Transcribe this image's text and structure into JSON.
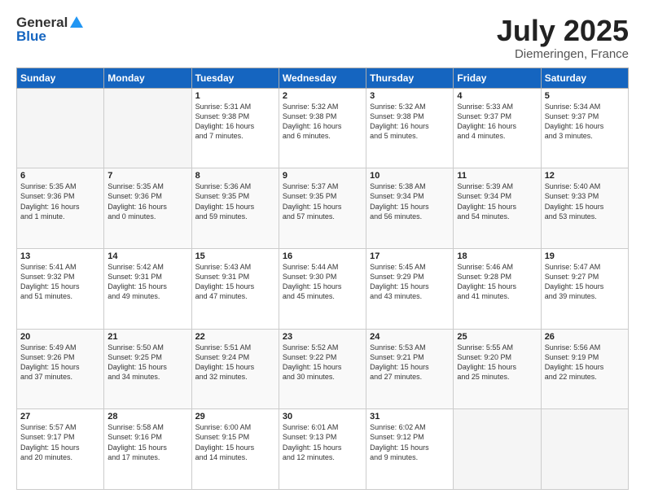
{
  "header": {
    "logo_general": "General",
    "logo_blue": "Blue",
    "title": "July 2025",
    "location": "Diemeringen, France"
  },
  "weekdays": [
    "Sunday",
    "Monday",
    "Tuesday",
    "Wednesday",
    "Thursday",
    "Friday",
    "Saturday"
  ],
  "weeks": [
    [
      {
        "day": "",
        "info": ""
      },
      {
        "day": "",
        "info": ""
      },
      {
        "day": "1",
        "info": "Sunrise: 5:31 AM\nSunset: 9:38 PM\nDaylight: 16 hours\nand 7 minutes."
      },
      {
        "day": "2",
        "info": "Sunrise: 5:32 AM\nSunset: 9:38 PM\nDaylight: 16 hours\nand 6 minutes."
      },
      {
        "day": "3",
        "info": "Sunrise: 5:32 AM\nSunset: 9:38 PM\nDaylight: 16 hours\nand 5 minutes."
      },
      {
        "day": "4",
        "info": "Sunrise: 5:33 AM\nSunset: 9:37 PM\nDaylight: 16 hours\nand 4 minutes."
      },
      {
        "day": "5",
        "info": "Sunrise: 5:34 AM\nSunset: 9:37 PM\nDaylight: 16 hours\nand 3 minutes."
      }
    ],
    [
      {
        "day": "6",
        "info": "Sunrise: 5:35 AM\nSunset: 9:36 PM\nDaylight: 16 hours\nand 1 minute."
      },
      {
        "day": "7",
        "info": "Sunrise: 5:35 AM\nSunset: 9:36 PM\nDaylight: 16 hours\nand 0 minutes."
      },
      {
        "day": "8",
        "info": "Sunrise: 5:36 AM\nSunset: 9:35 PM\nDaylight: 15 hours\nand 59 minutes."
      },
      {
        "day": "9",
        "info": "Sunrise: 5:37 AM\nSunset: 9:35 PM\nDaylight: 15 hours\nand 57 minutes."
      },
      {
        "day": "10",
        "info": "Sunrise: 5:38 AM\nSunset: 9:34 PM\nDaylight: 15 hours\nand 56 minutes."
      },
      {
        "day": "11",
        "info": "Sunrise: 5:39 AM\nSunset: 9:34 PM\nDaylight: 15 hours\nand 54 minutes."
      },
      {
        "day": "12",
        "info": "Sunrise: 5:40 AM\nSunset: 9:33 PM\nDaylight: 15 hours\nand 53 minutes."
      }
    ],
    [
      {
        "day": "13",
        "info": "Sunrise: 5:41 AM\nSunset: 9:32 PM\nDaylight: 15 hours\nand 51 minutes."
      },
      {
        "day": "14",
        "info": "Sunrise: 5:42 AM\nSunset: 9:31 PM\nDaylight: 15 hours\nand 49 minutes."
      },
      {
        "day": "15",
        "info": "Sunrise: 5:43 AM\nSunset: 9:31 PM\nDaylight: 15 hours\nand 47 minutes."
      },
      {
        "day": "16",
        "info": "Sunrise: 5:44 AM\nSunset: 9:30 PM\nDaylight: 15 hours\nand 45 minutes."
      },
      {
        "day": "17",
        "info": "Sunrise: 5:45 AM\nSunset: 9:29 PM\nDaylight: 15 hours\nand 43 minutes."
      },
      {
        "day": "18",
        "info": "Sunrise: 5:46 AM\nSunset: 9:28 PM\nDaylight: 15 hours\nand 41 minutes."
      },
      {
        "day": "19",
        "info": "Sunrise: 5:47 AM\nSunset: 9:27 PM\nDaylight: 15 hours\nand 39 minutes."
      }
    ],
    [
      {
        "day": "20",
        "info": "Sunrise: 5:49 AM\nSunset: 9:26 PM\nDaylight: 15 hours\nand 37 minutes."
      },
      {
        "day": "21",
        "info": "Sunrise: 5:50 AM\nSunset: 9:25 PM\nDaylight: 15 hours\nand 34 minutes."
      },
      {
        "day": "22",
        "info": "Sunrise: 5:51 AM\nSunset: 9:24 PM\nDaylight: 15 hours\nand 32 minutes."
      },
      {
        "day": "23",
        "info": "Sunrise: 5:52 AM\nSunset: 9:22 PM\nDaylight: 15 hours\nand 30 minutes."
      },
      {
        "day": "24",
        "info": "Sunrise: 5:53 AM\nSunset: 9:21 PM\nDaylight: 15 hours\nand 27 minutes."
      },
      {
        "day": "25",
        "info": "Sunrise: 5:55 AM\nSunset: 9:20 PM\nDaylight: 15 hours\nand 25 minutes."
      },
      {
        "day": "26",
        "info": "Sunrise: 5:56 AM\nSunset: 9:19 PM\nDaylight: 15 hours\nand 22 minutes."
      }
    ],
    [
      {
        "day": "27",
        "info": "Sunrise: 5:57 AM\nSunset: 9:17 PM\nDaylight: 15 hours\nand 20 minutes."
      },
      {
        "day": "28",
        "info": "Sunrise: 5:58 AM\nSunset: 9:16 PM\nDaylight: 15 hours\nand 17 minutes."
      },
      {
        "day": "29",
        "info": "Sunrise: 6:00 AM\nSunset: 9:15 PM\nDaylight: 15 hours\nand 14 minutes."
      },
      {
        "day": "30",
        "info": "Sunrise: 6:01 AM\nSunset: 9:13 PM\nDaylight: 15 hours\nand 12 minutes."
      },
      {
        "day": "31",
        "info": "Sunrise: 6:02 AM\nSunset: 9:12 PM\nDaylight: 15 hours\nand 9 minutes."
      },
      {
        "day": "",
        "info": ""
      },
      {
        "day": "",
        "info": ""
      }
    ]
  ]
}
